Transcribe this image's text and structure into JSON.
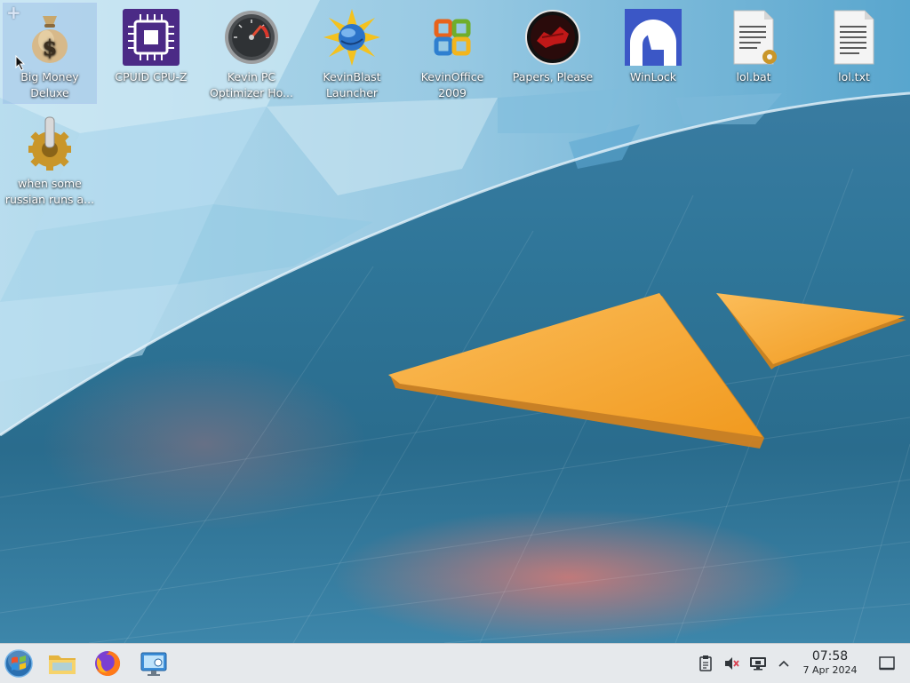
{
  "desktop": {
    "icons": [
      {
        "label": "Big Money Deluxe",
        "icon": "money-bag-icon"
      },
      {
        "label": "CPUID CPU-Z",
        "icon": "cpu-chip-icon"
      },
      {
        "label": "Kevin PC Optimizer Ho...",
        "icon": "speedometer-icon"
      },
      {
        "label": "KevinBlast Launcher",
        "icon": "starburst-globe-icon"
      },
      {
        "label": "KevinOffice 2009",
        "icon": "office-logo-icon"
      },
      {
        "label": "Papers, Please",
        "icon": "red-seal-icon"
      },
      {
        "label": "WinLock",
        "icon": "lock-arc-icon"
      },
      {
        "label": "lol.bat",
        "icon": "batch-file-icon"
      },
      {
        "label": "lol.txt",
        "icon": "text-file-icon"
      },
      {
        "label": "when some russian runs a...",
        "icon": "gear-icon"
      }
    ],
    "add_widget_icon": "plus-icon"
  },
  "taskbar": {
    "start_icon": "start-orb-icon",
    "pinned": [
      {
        "name": "file-manager",
        "icon": "folder-icon"
      },
      {
        "name": "firefox",
        "icon": "firefox-icon"
      },
      {
        "name": "remote-desktop",
        "icon": "monitor-icon"
      }
    ],
    "tray": [
      {
        "name": "clipboard",
        "icon": "clipboard-icon"
      },
      {
        "name": "volume-muted",
        "icon": "speaker-muted-icon"
      },
      {
        "name": "display",
        "icon": "display-icon"
      },
      {
        "name": "expand-tray",
        "icon": "chevron-up-icon"
      },
      {
        "name": "show-desktop",
        "icon": "desktop-square-icon"
      }
    ],
    "clock": {
      "time": "07:58",
      "date": "7 Apr 2024"
    }
  },
  "colors": {
    "wallpaper_blue": "#2f7699",
    "wallpaper_light": "#a9d5ea",
    "triangle_orange": "#f5a42c",
    "taskbar_bg": "#e6e9ec",
    "text_dark": "#232629"
  }
}
